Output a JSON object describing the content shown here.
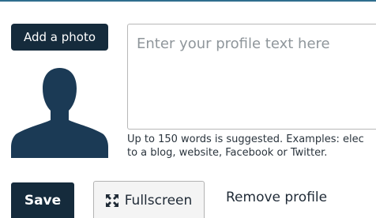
{
  "colors": {
    "primary_button": "#152b3c",
    "top_rule": "#2f6e8e",
    "secondary_button_bg": "#f4f4f4",
    "avatar": "#1b3a55"
  },
  "photo": {
    "add_label": "Add a photo",
    "avatar_icon": "person-silhouette-icon"
  },
  "profile": {
    "placeholder": "Enter your profile text here",
    "value": "",
    "hint_line1": "Up to 150 words is suggested. Examples: elec",
    "hint_line2": "to a blog, website, Facebook or Twitter."
  },
  "actions": {
    "save_label": "Save",
    "fullscreen_label": "Fullscreen",
    "fullscreen_icon": "expand-arrows-icon",
    "remove_label": "Remove profile"
  }
}
